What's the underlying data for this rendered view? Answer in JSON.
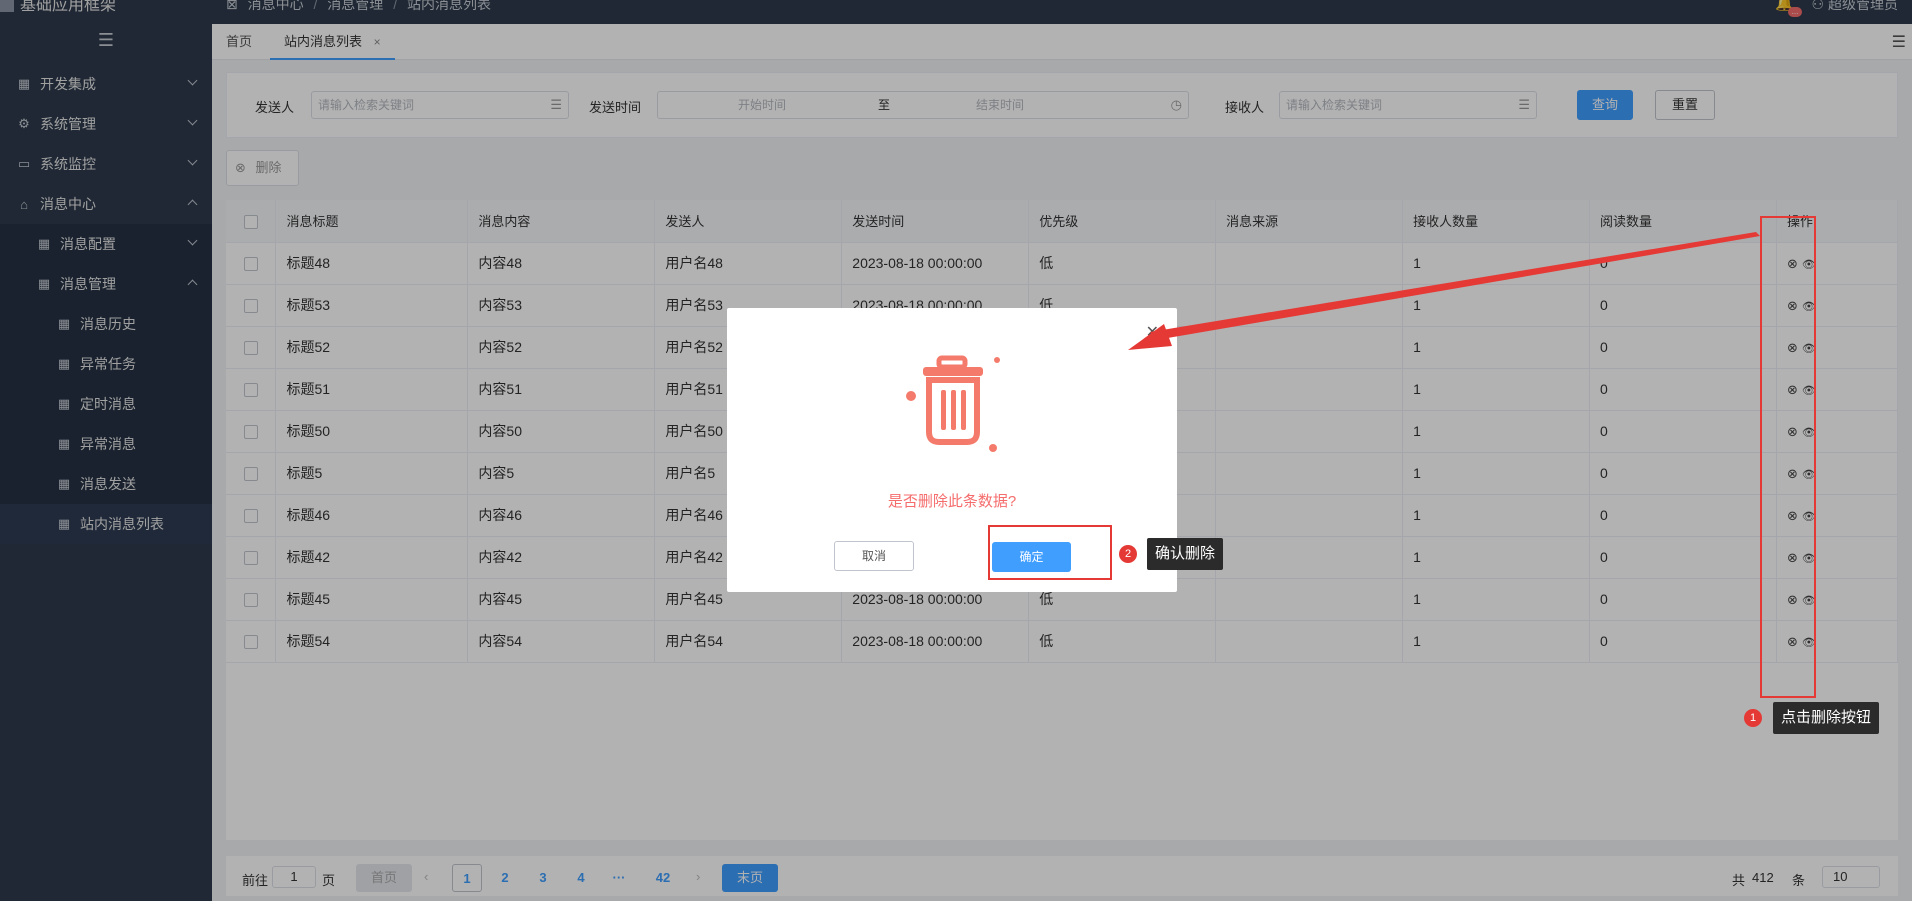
{
  "app": {
    "title": "基础应用框架"
  },
  "sidebar": {
    "items": [
      {
        "label": "开发集成"
      },
      {
        "label": "系统管理"
      },
      {
        "label": "系统监控"
      },
      {
        "label": "消息中心"
      },
      {
        "label": "消息配置"
      },
      {
        "label": "消息管理"
      },
      {
        "label": "消息历史"
      },
      {
        "label": "异常任务"
      },
      {
        "label": "定时消息"
      },
      {
        "label": "异常消息"
      },
      {
        "label": "消息发送"
      },
      {
        "label": "站内消息列表"
      }
    ]
  },
  "header": {
    "breadcrumb": [
      "消息中心",
      "消息管理",
      "站内消息列表"
    ],
    "notification_badge": "...",
    "user": "超级管理员"
  },
  "tabs": [
    {
      "label": "首页"
    },
    {
      "label": "站内消息列表",
      "close": "×"
    }
  ],
  "filter": {
    "sender_label": "发送人",
    "sender_placeholder": "请输入检索关键词",
    "time_label": "发送时间",
    "start_placeholder": "开始时间",
    "range_sep": "至",
    "end_placeholder": "结束时间",
    "receiver_label": "接收人",
    "receiver_placeholder": "请输入检索关键词",
    "query_btn": "查询",
    "reset_btn": "重置"
  },
  "toolbar": {
    "delete_btn": "删除"
  },
  "table": {
    "columns": [
      "消息标题",
      "消息内容",
      "发送人",
      "发送时间",
      "优先级",
      "消息来源",
      "接收人数量",
      "阅读数量",
      "操作"
    ],
    "rows": [
      [
        "标题48",
        "内容48",
        "用户名48",
        "2023-08-18 00:00:00",
        "低",
        "",
        "1",
        "0"
      ],
      [
        "标题53",
        "内容53",
        "用户名53",
        "2023-08-18 00:00:00",
        "低",
        "",
        "1",
        "0"
      ],
      [
        "标题52",
        "内容52",
        "用户名52",
        "",
        "",
        "",
        "1",
        "0"
      ],
      [
        "标题51",
        "内容51",
        "用户名51",
        "",
        "",
        "",
        "1",
        "0"
      ],
      [
        "标题50",
        "内容50",
        "用户名50",
        "",
        "",
        "",
        "1",
        "0"
      ],
      [
        "标题5",
        "内容5",
        "用户名5",
        "",
        "",
        "",
        "1",
        "0"
      ],
      [
        "标题46",
        "内容46",
        "用户名46",
        "",
        "",
        "",
        "1",
        "0"
      ],
      [
        "标题42",
        "内容42",
        "用户名42",
        "",
        "",
        "",
        "1",
        "0"
      ],
      [
        "标题45",
        "内容45",
        "用户名45",
        "2023-08-18 00:00:00",
        "低",
        "",
        "1",
        "0"
      ],
      [
        "标题54",
        "内容54",
        "用户名54",
        "2023-08-18 00:00:00",
        "低",
        "",
        "1",
        "0"
      ]
    ]
  },
  "pagination": {
    "goto_prefix": "前往",
    "goto_value": "1",
    "goto_suffix": "页",
    "first_btn": "首页",
    "pages": [
      "1",
      "2",
      "3",
      "4",
      "···",
      "42"
    ],
    "current_page": "1",
    "last_btn": "末页",
    "total_prefix": "共",
    "total": "412",
    "total_suffix": "条",
    "page_size": "10"
  },
  "dialog": {
    "message": "是否删除此条数据?",
    "cancel_btn": "取消",
    "confirm_btn": "确定"
  },
  "annotations": {
    "step1": {
      "number": "1",
      "text": "点击删除按钮"
    },
    "step2": {
      "number": "2",
      "text": "确认删除"
    }
  },
  "colors": {
    "sidebar_bg": "#2d3a4b",
    "primary": "#409eff",
    "danger": "#f56c6c",
    "annotation": "#e53935"
  }
}
